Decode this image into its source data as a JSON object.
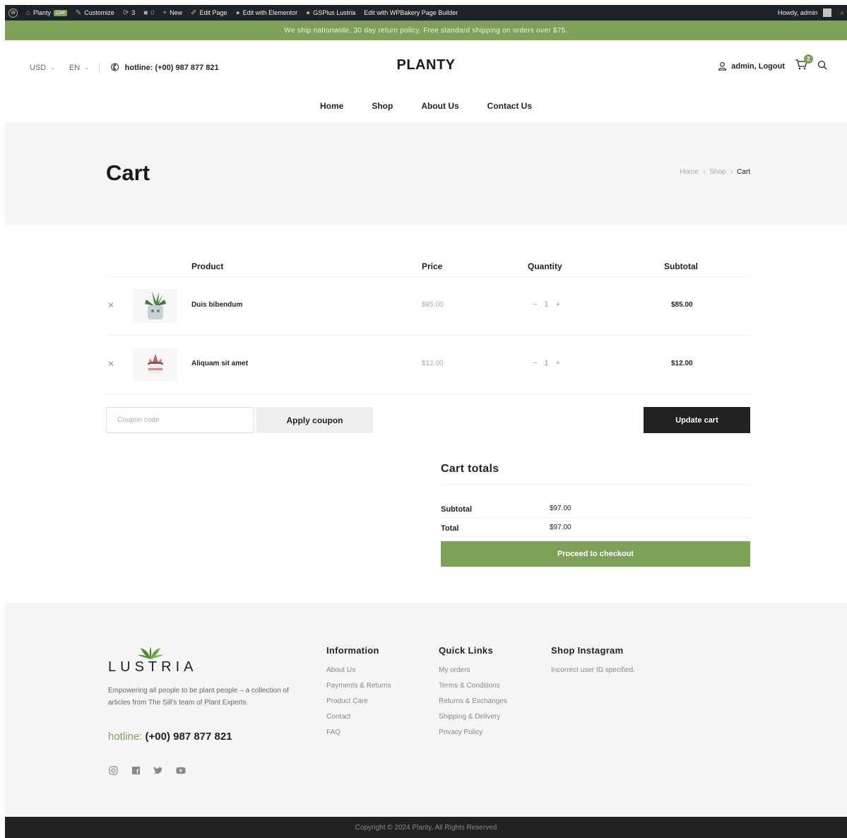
{
  "adminbar": {
    "site_name": "Planty",
    "live_label": "Live",
    "customize": "Customize",
    "updates_count": "3",
    "comments_count": "0",
    "new": "New",
    "edit_page": "Edit Page",
    "edit_elementor": "Edit with Elementor",
    "gsplus": "GSPlus Lustria",
    "edit_wpbakery": "Edit with WPBakery Page Builder",
    "howdy": "Howdy, admin"
  },
  "notice": "We ship nationwide. 30 day return policy. Free standard shipping on orders over $75.",
  "header": {
    "currency": "USD",
    "language": "EN",
    "hotline": "hotline: (+00) 987 877 821",
    "brand": "PLANTY",
    "account": "admin, Logout",
    "cart_count": "2",
    "nav": [
      "Home",
      "Shop",
      "About Us",
      "Contact Us"
    ]
  },
  "page": {
    "title": "Cart",
    "breadcrumb": [
      "Home",
      "Shop",
      "Cart"
    ]
  },
  "cart": {
    "columns": [
      "Product",
      "Price",
      "Quantity",
      "Subtotal"
    ],
    "items": [
      {
        "name": "Duis bibendum",
        "price": "$85.00",
        "qty": "1",
        "subtotal": "$85.00"
      },
      {
        "name": "Aliquam sit amet",
        "price": "$12.00",
        "qty": "1",
        "subtotal": "$12.00"
      }
    ],
    "coupon_placeholder": "Coupon code",
    "apply_label": "Apply coupon",
    "update_label": "Update cart"
  },
  "totals": {
    "title": "Cart totals",
    "subtotal_label": "Subtotal",
    "subtotal_value": "$97.00",
    "total_label": "Total",
    "total_value": "$97.00",
    "checkout_label": "Proceed to checkout"
  },
  "footer": {
    "logo_text": "LUSTRIA",
    "description": "Empowering all people to be plant people – a collection of articles from The Sill's team of Plant Experts.",
    "hotline_label": "hotline:",
    "hotline_number": "(+00) 987 877 821",
    "information": {
      "title": "Information",
      "links": [
        "About Us",
        "Payments & Returns",
        "Product Care",
        "Contact",
        "FAQ"
      ]
    },
    "quick_links": {
      "title": "Quick Links",
      "links": [
        "My orders",
        "Terms & Conditions",
        "Returns & Exchanges",
        "Shipping & Delivery",
        "Privacy Policy"
      ]
    },
    "instagram": {
      "title": "Shop Instagram",
      "message": "Incorrect user ID specified."
    },
    "copyright": "Copyright © 2024 Planty. All Rights Reserved"
  },
  "colors": {
    "accent": "#7fa059",
    "dark": "#222222",
    "adminbar": "#1d2327"
  }
}
